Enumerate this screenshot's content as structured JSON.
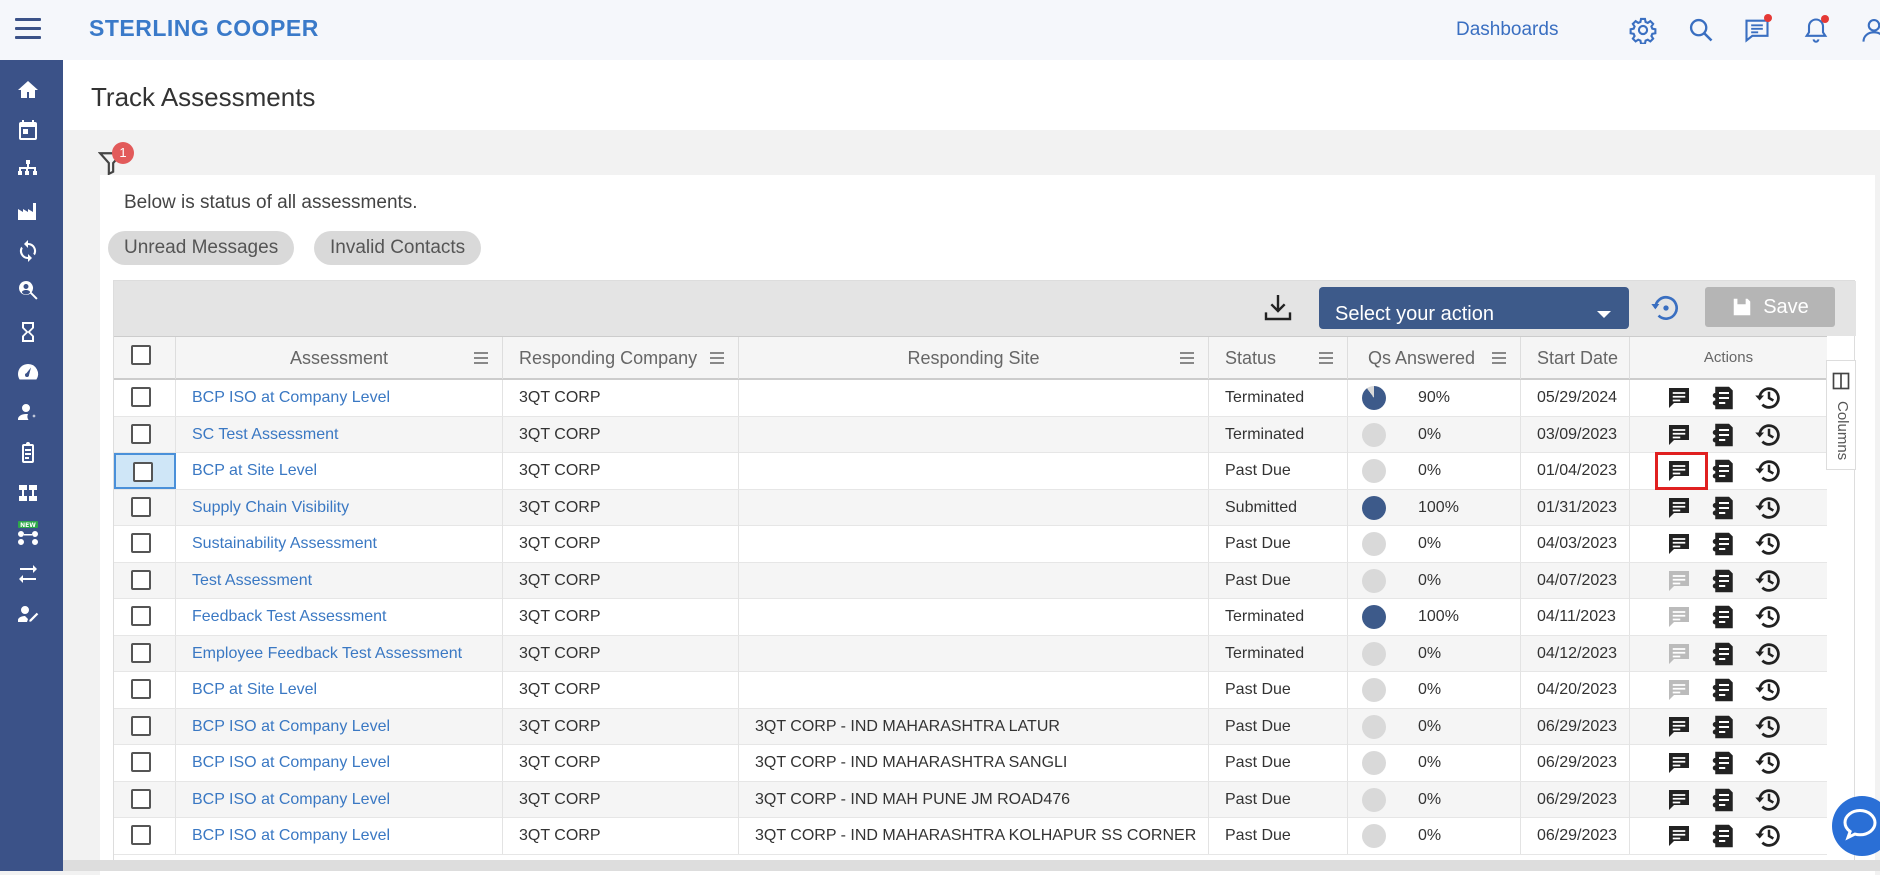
{
  "brand": "STERLING COOPER",
  "header": {
    "dashboards_label": "Dashboards"
  },
  "page": {
    "title": "Track Assessments",
    "filter_count": "1",
    "status_text": "Below is status of all assessments."
  },
  "chips": [
    "Unread Messages",
    "Invalid Contacts"
  ],
  "toolbar": {
    "action_placeholder": "Select your action",
    "save_label": "Save"
  },
  "columns": {
    "assessment": "Assessment",
    "responding_company": "Responding Company",
    "responding_site": "Responding Site",
    "status": "Status",
    "qs_answered": "Qs Answered",
    "start_date": "Start Date",
    "actions": "Actions"
  },
  "columns_tab_label": "Columns",
  "rows": [
    {
      "assessment": "BCP ISO at Company Level",
      "company": "3QT CORP",
      "site": "",
      "status": "Terminated",
      "qs": "90%",
      "qs_value": 0.9,
      "start": "05/29/2024",
      "msg_active": true
    },
    {
      "assessment": "SC Test Assessment",
      "company": "3QT CORP",
      "site": "",
      "status": "Terminated",
      "qs": "0%",
      "qs_value": 0,
      "start": "03/09/2023",
      "msg_active": true
    },
    {
      "assessment": "BCP at Site Level",
      "company": "3QT CORP",
      "site": "",
      "status": "Past Due",
      "qs": "0%",
      "qs_value": 0,
      "start": "01/04/2023",
      "msg_active": true
    },
    {
      "assessment": "Supply Chain Visibility",
      "company": "3QT CORP",
      "site": "",
      "status": "Submitted",
      "qs": "100%",
      "qs_value": 1,
      "start": "01/31/2023",
      "msg_active": true
    },
    {
      "assessment": "Sustainability Assessment",
      "company": "3QT CORP",
      "site": "",
      "status": "Past Due",
      "qs": "0%",
      "qs_value": 0,
      "start": "04/03/2023",
      "msg_active": true
    },
    {
      "assessment": "Test Assessment",
      "company": "3QT CORP",
      "site": "",
      "status": "Past Due",
      "qs": "0%",
      "qs_value": 0,
      "start": "04/07/2023",
      "msg_active": false
    },
    {
      "assessment": "Feedback Test Assessment",
      "company": "3QT CORP",
      "site": "",
      "status": "Terminated",
      "qs": "100%",
      "qs_value": 1,
      "start": "04/11/2023",
      "msg_active": false
    },
    {
      "assessment": "Employee Feedback Test Assessment",
      "company": "3QT CORP",
      "site": "",
      "status": "Terminated",
      "qs": "0%",
      "qs_value": 0,
      "start": "04/12/2023",
      "msg_active": false
    },
    {
      "assessment": "BCP at Site Level",
      "company": "3QT CORP",
      "site": "",
      "status": "Past Due",
      "qs": "0%",
      "qs_value": 0,
      "start": "04/20/2023",
      "msg_active": false
    },
    {
      "assessment": "BCP ISO at Company Level",
      "company": "3QT CORP",
      "site": "3QT CORP - IND MAHARASHTRA LATUR",
      "status": "Past Due",
      "qs": "0%",
      "qs_value": 0,
      "start": "06/29/2023",
      "msg_active": true
    },
    {
      "assessment": "BCP ISO at Company Level",
      "company": "3QT CORP",
      "site": "3QT CORP - IND MAHARASHTRA SANGLI",
      "status": "Past Due",
      "qs": "0%",
      "qs_value": 0,
      "start": "06/29/2023",
      "msg_active": true
    },
    {
      "assessment": "BCP ISO at Company Level",
      "company": "3QT CORP",
      "site": "3QT CORP - IND MAH PUNE JM ROAD476",
      "status": "Past Due",
      "qs": "0%",
      "qs_value": 0,
      "start": "06/29/2023",
      "msg_active": true
    },
    {
      "assessment": "BCP ISO at Company Level",
      "company": "3QT CORP",
      "site": "3QT CORP - IND MAHARASHTRA KOLHAPUR SS CORNER",
      "status": "Past Due",
      "qs": "0%",
      "qs_value": 0,
      "start": "06/29/2023",
      "msg_active": true
    }
  ],
  "colors": {
    "sidebar": "#3b5288",
    "brand": "#3a7ac9",
    "link": "#3a78c3",
    "pie_fill": "#3d5a8a",
    "pie_empty": "#d9d9d9",
    "highlight": "#e02020"
  },
  "icons": {
    "sidebar": [
      "home-icon",
      "calendar-icon",
      "hierarchy-icon",
      "factory-icon",
      "refresh-cycle-icon",
      "search-person-icon",
      "hourglass-icon",
      "gauge-icon",
      "user-settings-icon",
      "clipboard-icon",
      "org-chart-icon",
      "new-feature-icon",
      "transfer-icon",
      "user-edit-icon"
    ],
    "header": [
      "gear-icon",
      "search-icon",
      "messages-icon",
      "bell-icon",
      "user-icon"
    ]
  }
}
